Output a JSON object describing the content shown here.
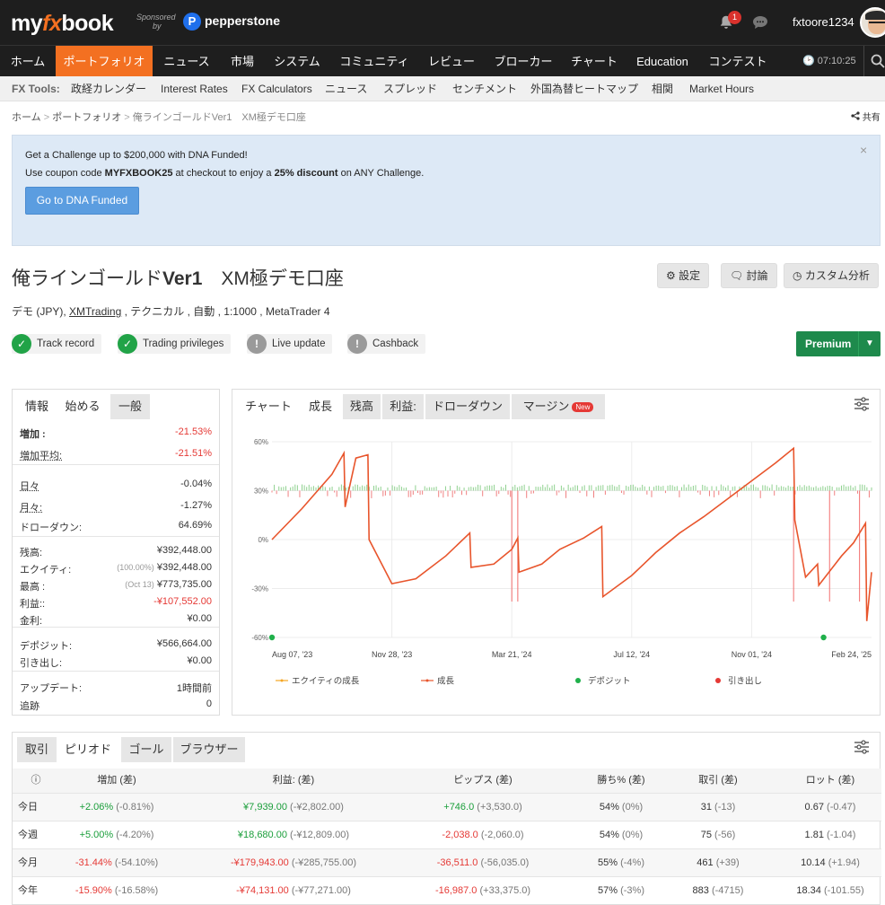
{
  "header": {
    "logo_my": "my",
    "logo_fx": "fx",
    "logo_book": "book",
    "sponsored_line1": "Sponsored",
    "sponsored_line2": "by",
    "sponsor_name": "pepperstone",
    "notif_count": "1",
    "username": "fxtoore1234"
  },
  "nav": {
    "items": [
      "ホーム",
      "ポートフォリオ",
      "ニュース",
      "市場",
      "システム",
      "コミュニティ",
      "レビュー",
      "ブローカー",
      "チャート",
      "Education",
      "コンテスト"
    ],
    "active_index": 1,
    "clock": "07:10:25"
  },
  "tools": {
    "label": "FX Tools:",
    "items": [
      "政経カレンダー",
      "Interest Rates",
      "FX Calculators",
      "ニュース",
      "スプレッド",
      "センチメント",
      "外国為替ヒートマップ",
      "相関",
      "Market Hours"
    ]
  },
  "breadcrumb": {
    "home": "ホーム",
    "portfolio": "ポートフォリオ",
    "current": "俺ラインゴールドVer1　XM極デモ口座",
    "share": "共有"
  },
  "promo": {
    "title": "Get a Challenge up to $200,000 with DNA Funded!",
    "text_a": "Use coupon code ",
    "code": "MYFXBOOK25",
    "text_b": " at checkout to enjoy a ",
    "discount": "25% discount",
    "text_c": " on ANY Challenge.",
    "button": "Go to DNA Funded",
    "close": "×"
  },
  "account": {
    "title_a": "俺ラインゴールド",
    "title_b": "Ver1",
    "title_c": "　XM極デモ口座",
    "btn_settings": "設定",
    "btn_discuss": "討論",
    "btn_custom": "カスタム分析",
    "meta_a": "デモ (JPY), ",
    "meta_broker": "XMTrading",
    "meta_b": " , テクニカル , 自動 , 1:1000 , MetaTrader 4",
    "badges": [
      {
        "label": "Track record",
        "state": "ok"
      },
      {
        "label": "Trading privileges",
        "state": "ok"
      },
      {
        "label": "Live update",
        "state": "warn"
      },
      {
        "label": "Cashback",
        "state": "warn"
      }
    ],
    "premium": "Premium"
  },
  "stats": {
    "tabs": [
      "情報",
      "始める",
      "一般"
    ],
    "rows": [
      {
        "k": "増加 :",
        "v": "-21.53%",
        "cls": "red",
        "bold": true
      },
      {
        "k": "増加平均:",
        "v": "-21.51%",
        "cls": "red",
        "u": true
      },
      {
        "k": "日々",
        "v": "-0.04%",
        "u": true
      },
      {
        "k": "月々:",
        "v": "-1.27%",
        "u": true
      },
      {
        "k": "ドローダウン:",
        "v": "64.69%"
      },
      {
        "k": "残高:",
        "v": "¥392,448.00"
      },
      {
        "k": "エクイティ:",
        "sub": "(100.00%)",
        "v": "¥392,448.00"
      },
      {
        "k": "最高 :",
        "sub": "(Oct 13)",
        "v": "¥773,735.00"
      },
      {
        "k": "利益::",
        "v": "-¥107,552.00",
        "cls": "red"
      },
      {
        "k": "金利:",
        "v": "¥0.00"
      },
      {
        "k": "デポジット:",
        "v": "¥566,664.00"
      },
      {
        "k": "引き出し:",
        "v": "¥0.00"
      },
      {
        "k": "アップデート:",
        "v": "1時間前"
      },
      {
        "k": "追跡",
        "v": "0"
      }
    ]
  },
  "chart_tabs": {
    "items": [
      "チャート",
      "成長",
      "残高",
      "利益:",
      "ドローダウン",
      "マージン"
    ],
    "active_index": 1,
    "new_badge": "New"
  },
  "chart_data": {
    "type": "line",
    "x_labels": [
      "Aug 07, '23",
      "Nov 28, '23",
      "Mar 21, '24",
      "Jul 12, '24",
      "Nov 01, '24",
      "Feb 24, '25"
    ],
    "y_labels": [
      "60%",
      "30%",
      "0%",
      "-30%",
      "-60%"
    ],
    "ylim": [
      -60,
      60
    ],
    "series": [
      {
        "name": "エクイティの成長",
        "color": "#f5a623"
      },
      {
        "name": "成長",
        "color": "#e8552c",
        "x": [
          0,
          0.05,
          0.1,
          0.12,
          0.122,
          0.14,
          0.16,
          0.162,
          0.2,
          0.24,
          0.29,
          0.33,
          0.332,
          0.37,
          0.4,
          0.41,
          0.412,
          0.45,
          0.48,
          0.52,
          0.55,
          0.552,
          0.6,
          0.62,
          0.64,
          0.68,
          0.72,
          0.76,
          0.8,
          0.84,
          0.87,
          0.872,
          0.89,
          0.91,
          0.912,
          0.95,
          0.97,
          0.99,
          0.992,
          1.0
        ],
        "y": [
          0,
          19,
          40,
          53,
          20,
          50,
          52,
          0,
          -27,
          -24,
          -10,
          4,
          -17,
          -15,
          -6,
          1,
          -20,
          -15,
          -6,
          1,
          8,
          -35,
          -22,
          -15,
          -8,
          4,
          14,
          25,
          36,
          47,
          56,
          12,
          -23,
          -15,
          -28,
          -10,
          -2,
          10,
          -50,
          -20
        ]
      },
      {
        "name": "デポジット",
        "color": "#20b04b",
        "x": [
          0,
          0.92
        ],
        "y": [
          -60,
          -60
        ]
      },
      {
        "name": "引き出し",
        "color": "#e53935"
      }
    ]
  },
  "periods": {
    "tabs": [
      "取引",
      "ピリオド",
      "ゴール",
      "ブラウザー"
    ],
    "headers": [
      "",
      "増加 (差)",
      "利益: (差)",
      "ピップス (差)",
      "勝ち% (差)",
      "取引 (差)",
      "ロット (差)"
    ],
    "rows": [
      {
        "label": "今日",
        "c": [
          [
            "+2.06%",
            "(-0.81%)",
            "green"
          ],
          [
            "¥7,939.00",
            "(-¥2,802.00)",
            "green"
          ],
          [
            "+746.0",
            "(+3,530.0)",
            "green"
          ],
          [
            "54%",
            "(0%)",
            ""
          ],
          [
            "31",
            "(-13)",
            ""
          ],
          [
            "0.67",
            "(-0.47)",
            ""
          ]
        ]
      },
      {
        "label": "今週",
        "c": [
          [
            "+5.00%",
            "(-4.20%)",
            "green"
          ],
          [
            "¥18,680.00",
            "(-¥12,809.00)",
            "green"
          ],
          [
            "-2,038.0",
            "(-2,060.0)",
            "red"
          ],
          [
            "54%",
            "(0%)",
            ""
          ],
          [
            "75",
            "(-56)",
            ""
          ],
          [
            "1.81",
            "(-1.04)",
            ""
          ]
        ]
      },
      {
        "label": "今月",
        "c": [
          [
            "-31.44%",
            "(-54.10%)",
            "red"
          ],
          [
            "-¥179,943.00",
            "(-¥285,755.00)",
            "red"
          ],
          [
            "-36,511.0",
            "(-56,035.0)",
            "red"
          ],
          [
            "55%",
            "(-4%)",
            ""
          ],
          [
            "461",
            "(+39)",
            ""
          ],
          [
            "10.14",
            "(+1.94)",
            ""
          ]
        ]
      },
      {
        "label": "今年",
        "c": [
          [
            "-15.90%",
            "(-16.58%)",
            "red"
          ],
          [
            "-¥74,131.00",
            "(-¥77,271.00)",
            "red"
          ],
          [
            "-16,987.0",
            "(+33,375.0)",
            "red"
          ],
          [
            "57%",
            "(-3%)",
            ""
          ],
          [
            "883",
            "(-4715)",
            ""
          ],
          [
            "18.34",
            "(-101.55)",
            ""
          ]
        ]
      }
    ]
  }
}
